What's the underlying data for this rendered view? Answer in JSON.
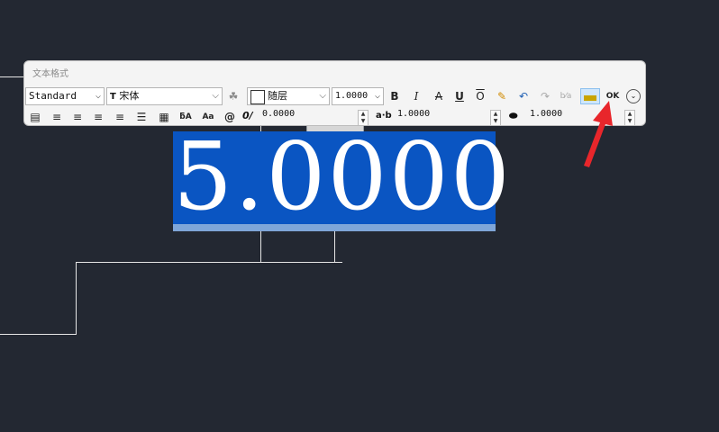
{
  "toolbar": {
    "title": "文本格式",
    "style_value": "Standard",
    "font_value": "宋体",
    "color_value": "随层",
    "height_value": "1.0000",
    "oblique_value": "0.0000",
    "tracking_value": "1.0000",
    "width_factor_value": "1.0000",
    "buttons": {
      "bold": "B",
      "italic": "I",
      "strike": "A",
      "underline": "U",
      "overline": "O",
      "ok": "OK"
    }
  },
  "editor": {
    "text": "5.0000"
  },
  "colors": {
    "canvas": "#232832",
    "editor_bg": "#0a55c2",
    "annotation": "#e8262b",
    "ok_highlight": "#cfe6fb"
  }
}
